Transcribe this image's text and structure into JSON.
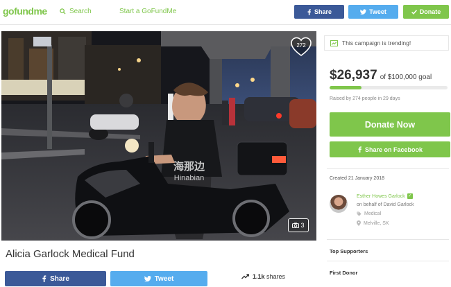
{
  "header": {
    "logo_prefix": "go",
    "logo_middle": "fund",
    "logo_suffix": "me",
    "search_label": "Search",
    "start_label": "Start a GoFundMe",
    "share_label": "Share",
    "tweet_label": "Tweet",
    "donate_label": "Donate"
  },
  "photo": {
    "likes": "272",
    "photo_count": "3",
    "watermark_cn": "海那边",
    "watermark_en": "Hinabian"
  },
  "campaign": {
    "title": "Alicia Garlock Medical Fund",
    "share_label": "Share",
    "tweet_label": "Tweet",
    "shares_count": "1.1k",
    "shares_label": "shares"
  },
  "sidebar": {
    "trending_text": "This campaign is trending!",
    "raised_amount": "$26,937",
    "goal_text": "of $100,000 goal",
    "progress_fraction": 0.269,
    "raised_meta": "Raised by 274 people in 29 days",
    "donate_now_label": "Donate Now",
    "share_facebook_label": "Share on Facebook",
    "created_text": "Created 21 January 2018",
    "organizer_name": "Esther Howes Garlock",
    "on_behalf_text": "on behalf of David Garlock",
    "category": "Medical",
    "location": "Melville, SK",
    "top_supporters_label": "Top Supporters",
    "first_donor_label": "First Donor"
  },
  "colors": {
    "brand_green": "#7fc64b",
    "facebook_blue": "#3b5998",
    "twitter_blue": "#55acee"
  },
  "icons": [
    "search-icon",
    "facebook-icon",
    "twitter-icon",
    "check-icon",
    "heart-icon",
    "camera-icon",
    "trending-icon",
    "tag-icon",
    "location-pin-icon",
    "share-trend-icon"
  ]
}
